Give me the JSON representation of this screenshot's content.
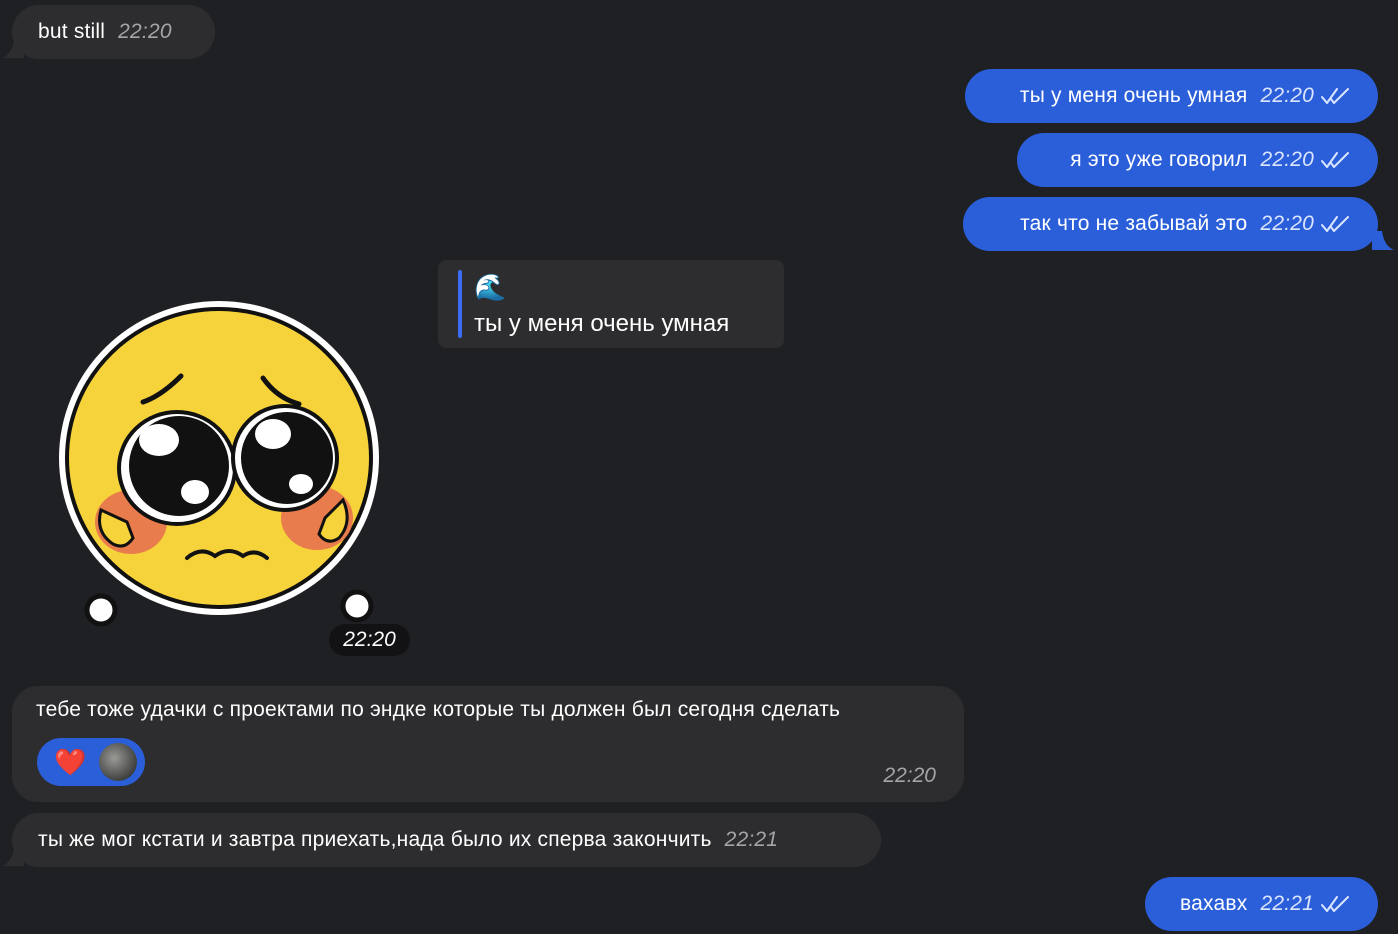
{
  "messages": [
    {
      "text": "but still",
      "time": "22:20"
    },
    {
      "text": "ты у меня очень умная",
      "time": "22:20"
    },
    {
      "text": "я это уже говорил",
      "time": "22:20"
    },
    {
      "text": "так что не забывай это",
      "time": "22:20"
    },
    {
      "text": "тебе тоже удачки с проектами по эндке которые ты должен был сегодня сделать",
      "time": "22:20"
    },
    {
      "text": "ты же мог кстати и завтра приехать,нада было их сперва закончить",
      "time": "22:21"
    },
    {
      "text": "вахавх",
      "time": "22:21"
    }
  ],
  "reply_quote": {
    "emoji": "🌊",
    "text": "ты у меня очень умная"
  },
  "sticker": {
    "icon": "pleading-face-sticker",
    "time": "22:20"
  },
  "reaction": {
    "emoji": "❤️"
  },
  "colors": {
    "background": "#1e2024",
    "incoming": "#2d2d2f",
    "outgoing": "#2b5fd9",
    "quote_bar": "#3a6cf4"
  }
}
